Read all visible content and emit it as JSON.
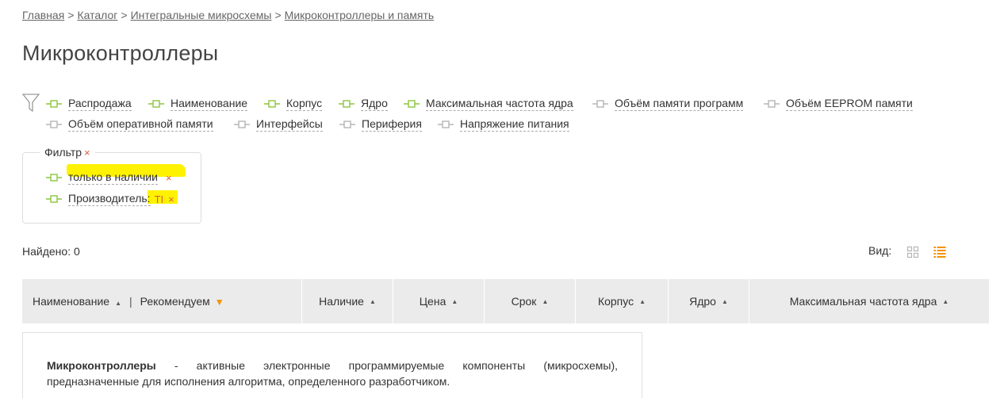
{
  "breadcrumb": {
    "items": [
      "Главная",
      "Каталог",
      "Интегральные микросхемы",
      "Микроконтроллеры и память"
    ],
    "separator": ">"
  },
  "page_title": "Микроконтроллеры",
  "columns_filter": {
    "active": [
      "Распродажа",
      "Наименование",
      "Корпус",
      "Ядро",
      "Максимальная частота ядра"
    ],
    "inactive": [
      "Объём памяти программ",
      "Объём EEPROM памяти",
      "Объём оперативной памяти",
      "Интерфейсы",
      "Периферия",
      "Напряжение питания"
    ]
  },
  "filter": {
    "legend": "Фильтр",
    "remove_glyph": "×",
    "items": [
      {
        "label": "только в наличии"
      },
      {
        "label": "Производитель:",
        "value": "TI"
      }
    ]
  },
  "found": "Найдено: 0",
  "view": {
    "label": "Вид:",
    "selected": "list"
  },
  "table": {
    "sort_up": "▲",
    "sort_down_active": "▼",
    "name_col": {
      "label": "Наименование",
      "divider": "|",
      "recommend": "Рекомендуем"
    },
    "columns": [
      "Наличие",
      "Цена",
      "Срок",
      "Корпус",
      "Ядро",
      "Максимальная частота ядра"
    ]
  },
  "description": {
    "term": "Микроконтроллеры",
    "text": " - активные электронные программируемые компоненты (микросхемы), предназначенные для исполнения алгоритма, определенного разработчиком."
  },
  "colors": {
    "active_toggle": "#8cc63f",
    "inactive_toggle": "#b5b5b5",
    "accent": "#f39200",
    "remove": "#e05a3a",
    "highlight": "#fff200",
    "table_head": "#ebebeb"
  },
  "icons": [
    "filter-funnel-icon",
    "toggle-on-icon",
    "toggle-off-icon",
    "grid-view-icon",
    "list-view-icon"
  ]
}
